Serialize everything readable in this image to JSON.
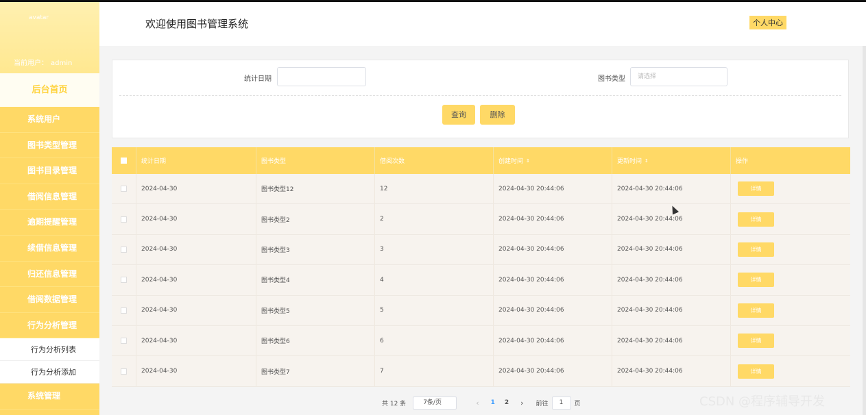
{
  "sidebar": {
    "avatar_alt": "avatar",
    "current_user_label": "当前用户：",
    "current_user": "admin",
    "home": "后台首页",
    "items": [
      {
        "label": "系统用户"
      },
      {
        "label": "图书类型管理"
      },
      {
        "label": "图书目录管理"
      },
      {
        "label": "借阅信息管理"
      },
      {
        "label": "逾期提醒管理"
      },
      {
        "label": "续借信息管理"
      },
      {
        "label": "归还信息管理"
      },
      {
        "label": "借阅数据管理"
      },
      {
        "label": "行为分析管理"
      }
    ],
    "subitems": [
      {
        "label": "行为分析列表"
      },
      {
        "label": "行为分析添加"
      }
    ],
    "last_item": "系统管理"
  },
  "header": {
    "title": "欢迎使用图书管理系统",
    "personal_center": "个人中心"
  },
  "search": {
    "date_label": "统计日期",
    "type_label": "图书类型",
    "type_placeholder": "请选择",
    "query_label": "查询",
    "delete_label": "删除"
  },
  "table": {
    "columns": [
      "统计日期",
      "图书类型",
      "借阅次数",
      "创建时间",
      "更新时间",
      "操作"
    ],
    "sort_icon": "⇕",
    "detail_label": "详情",
    "rows": [
      {
        "date": "2024-04-30",
        "type": "图书类型12",
        "count": "12",
        "created": "2024-04-30 20:44:06",
        "updated": "2024-04-30 20:44:06"
      },
      {
        "date": "2024-04-30",
        "type": "图书类型2",
        "count": "2",
        "created": "2024-04-30 20:44:06",
        "updated": "2024-04-30 20:44:06"
      },
      {
        "date": "2024-04-30",
        "type": "图书类型3",
        "count": "3",
        "created": "2024-04-30 20:44:06",
        "updated": "2024-04-30 20:44:06"
      },
      {
        "date": "2024-04-30",
        "type": "图书类型4",
        "count": "4",
        "created": "2024-04-30 20:44:06",
        "updated": "2024-04-30 20:44:06"
      },
      {
        "date": "2024-04-30",
        "type": "图书类型5",
        "count": "5",
        "created": "2024-04-30 20:44:06",
        "updated": "2024-04-30 20:44:06"
      },
      {
        "date": "2024-04-30",
        "type": "图书类型6",
        "count": "6",
        "created": "2024-04-30 20:44:06",
        "updated": "2024-04-30 20:44:06"
      },
      {
        "date": "2024-04-30",
        "type": "图书类型7",
        "count": "7",
        "created": "2024-04-30 20:44:06",
        "updated": "2024-04-30 20:44:06"
      }
    ]
  },
  "pagination": {
    "total": "共 12 条",
    "page_size": "7条/页",
    "prev": "‹",
    "pages": [
      "1",
      "2"
    ],
    "next": "›",
    "goto_label": "前往",
    "goto_value": "1",
    "page_unit": "页"
  },
  "watermark": "CSDN @程序辅导开发"
}
